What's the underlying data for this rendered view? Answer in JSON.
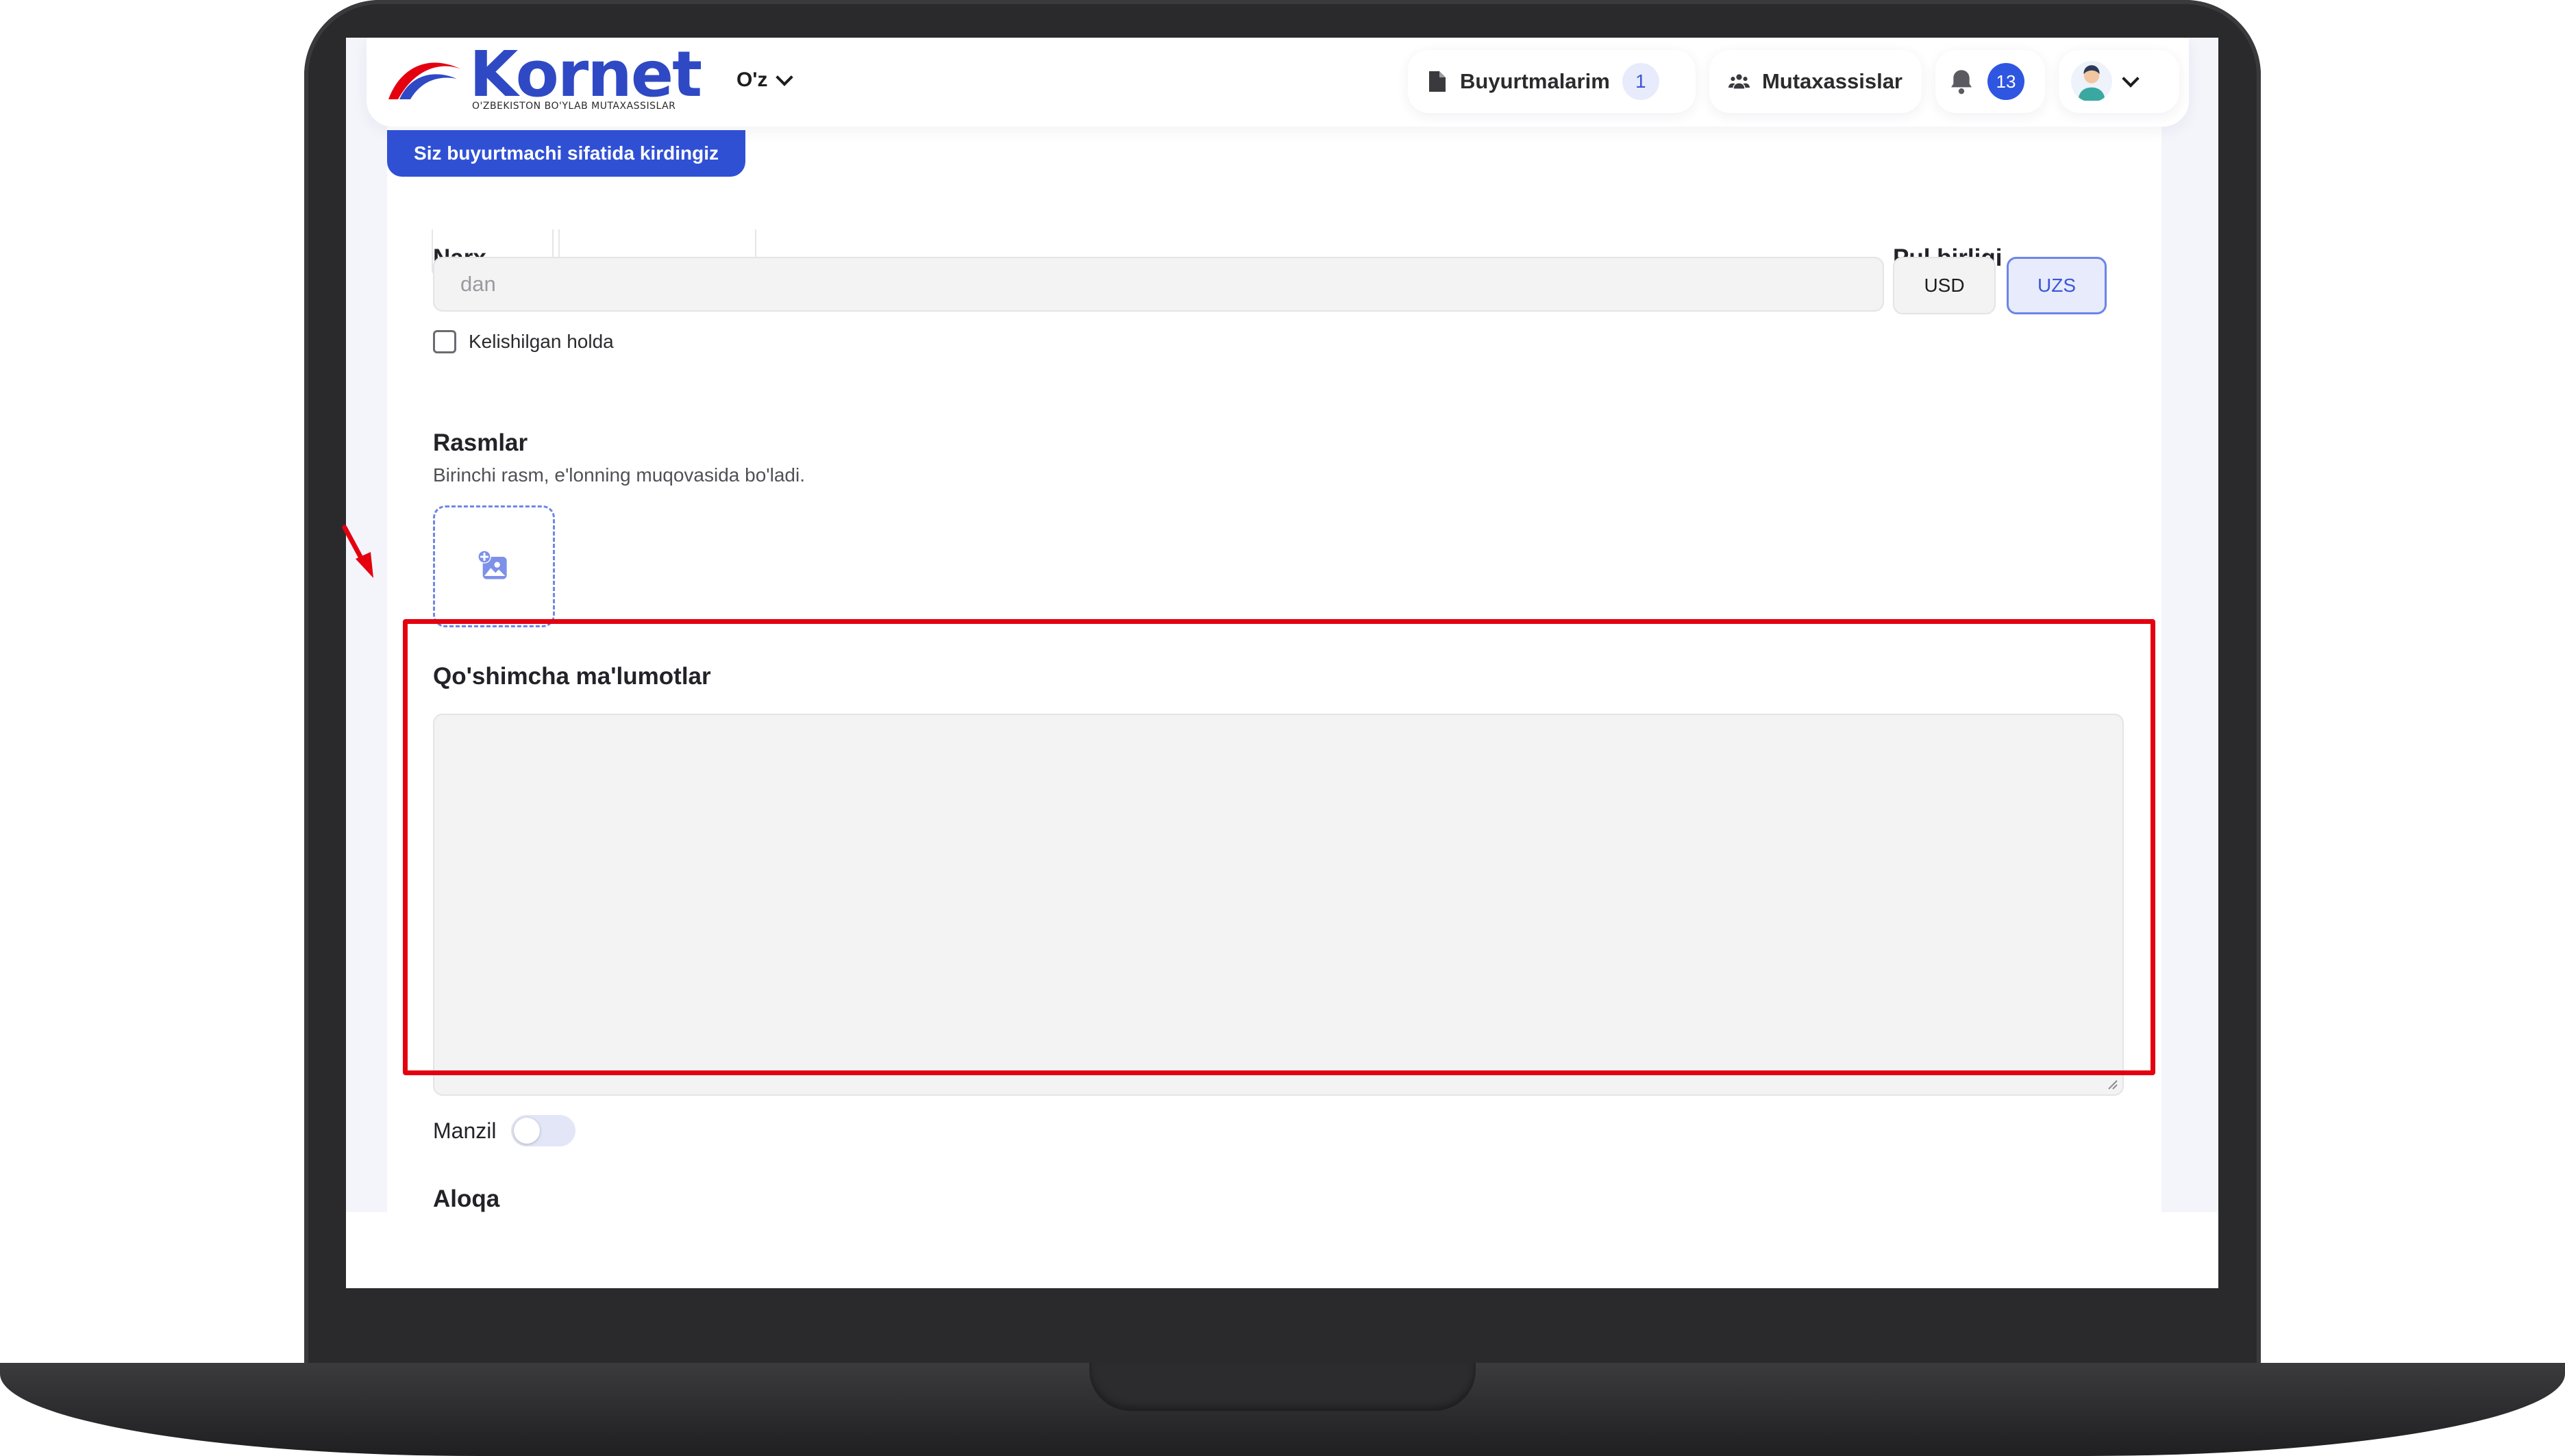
{
  "header": {
    "logo_text": "Kornet",
    "logo_tagline": "O'ZBEKISTON BO'YLAB MUTAXASSISLAR",
    "language": "O'z",
    "orders_label": "Buyurtmalarim",
    "orders_count": "1",
    "specialists_label": "Mutaxassislar",
    "notifications_count": "13"
  },
  "notice": "Siz buyurtmachi sifatida kirdingiz",
  "form": {
    "price_label": "Narx",
    "price_placeholder": "dan",
    "currency_label": "Pul birligi",
    "currency_options": [
      "USD",
      "UZS"
    ],
    "currency_selected": "UZS",
    "negotiable_label": "Kelishilgan holda",
    "negotiable_checked": false,
    "images_label": "Rasmlar",
    "images_hint": "Birinchi rasm, e'lonning muqovasida bo'ladi.",
    "additional_info_label": "Qo'shimcha ma'lumotlar",
    "additional_info_value": "",
    "address_label": "Manzil",
    "address_enabled": false,
    "contact_label": "Aloqa"
  },
  "icons": {
    "orders": "document-icon",
    "specialists": "users-icon",
    "notifications": "bell-icon",
    "user": "avatar-icon",
    "upload": "image-plus-icon"
  },
  "colors": {
    "brand_blue": "#2f49c5",
    "brand_red": "#e4000f",
    "accent": "#3050d4",
    "highlight": "#e4000f"
  }
}
